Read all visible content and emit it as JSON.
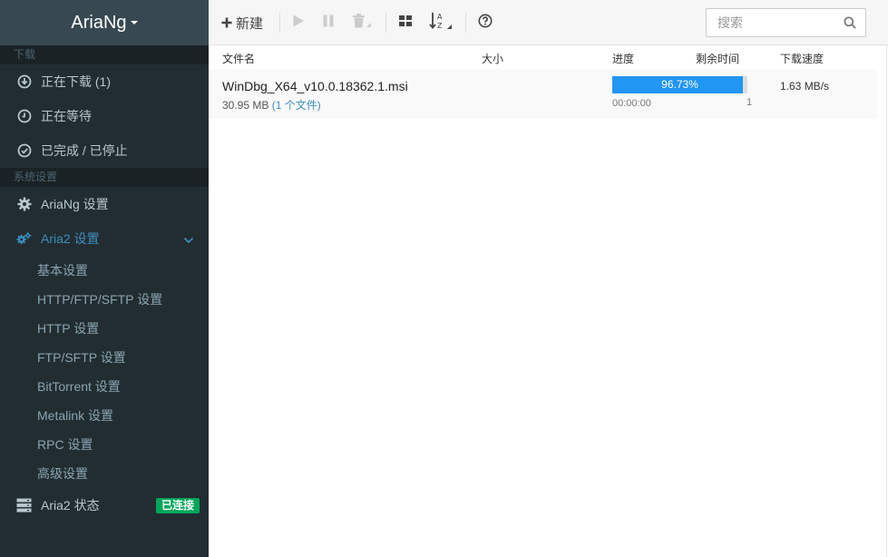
{
  "brand": {
    "title": "AriaNg"
  },
  "sidebar": {
    "downloads_header": "下载",
    "downloads": [
      {
        "label": "正在下载 (1)",
        "icon": "download-circle-icon"
      },
      {
        "label": "正在等待",
        "icon": "clock-icon"
      },
      {
        "label": "已完成 / 已停止",
        "icon": "check-circle-icon"
      }
    ],
    "settings_header": "系统设置",
    "ariang_settings": "AriaNg 设置",
    "aria2_settings": "Aria2 设置",
    "aria2_sub": [
      "基本设置",
      "HTTP/FTP/SFTP 设置",
      "HTTP 设置",
      "FTP/SFTP 设置",
      "BitTorrent 设置",
      "Metalink 设置",
      "RPC 设置",
      "高级设置"
    ],
    "aria2_status": "Aria2 状态",
    "status_badge": "已连接"
  },
  "toolbar": {
    "new_label": "新建",
    "search_placeholder": "搜索"
  },
  "table": {
    "headers": {
      "name": "文件名",
      "size": "大小",
      "progress": "进度",
      "remaining": "剩余时间",
      "speed": "下载速度"
    },
    "rows": [
      {
        "name": "WinDbg_X64_v10.0.18362.1.msi",
        "size": "30.95 MB",
        "files": "(1 个文件)",
        "progress_text": "96.73%",
        "progress": 0.9673,
        "remaining": "00:00:00",
        "connections": "1",
        "speed": "1.63 MB/s"
      }
    ]
  },
  "colors": {
    "sidebar": "#222d32",
    "accent": "#3c8dbc",
    "progress": "#2196f3",
    "badge": "#00a65a"
  }
}
